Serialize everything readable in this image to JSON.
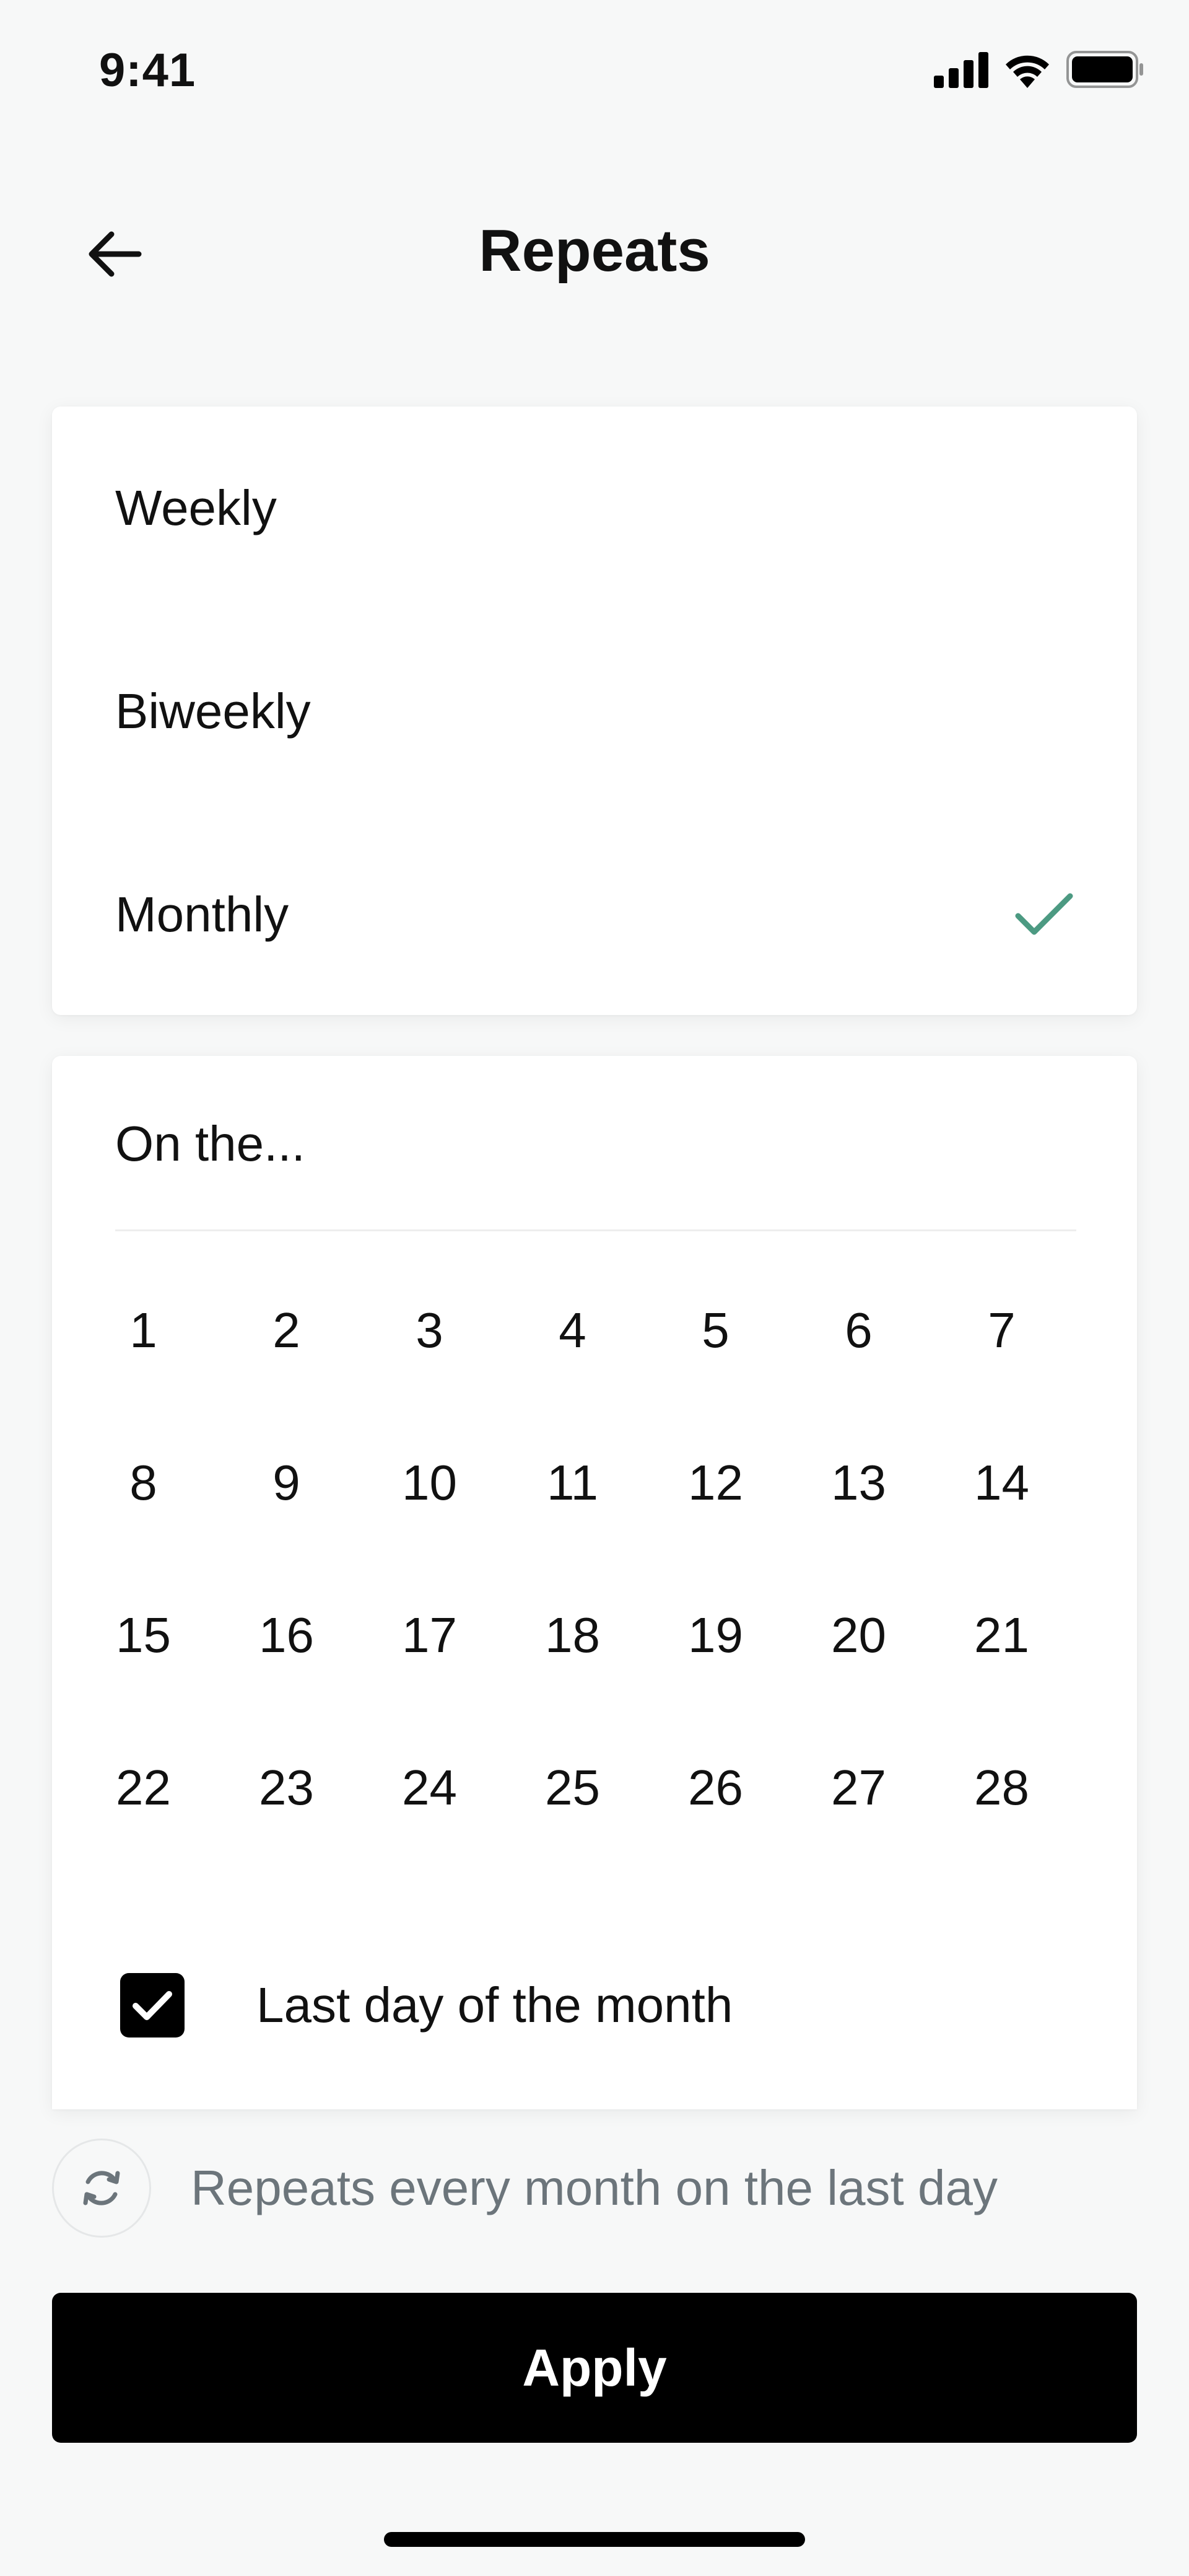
{
  "status_bar": {
    "time": "9:41",
    "icons": [
      "cellular-signal-icon",
      "wifi-icon",
      "battery-icon"
    ]
  },
  "header": {
    "title": "Repeats",
    "back_icon": "arrow-left-icon"
  },
  "frequency": {
    "options": [
      {
        "label": "Weekly",
        "selected": false
      },
      {
        "label": "Biweekly",
        "selected": false
      },
      {
        "label": "Monthly",
        "selected": true
      }
    ],
    "check_icon": "checkmark-icon",
    "accent_color": "#4c9a82"
  },
  "day_picker": {
    "heading": "On the...",
    "days": [
      "1",
      "2",
      "3",
      "4",
      "5",
      "6",
      "7",
      "8",
      "9",
      "10",
      "11",
      "12",
      "13",
      "14",
      "15",
      "16",
      "17",
      "18",
      "19",
      "20",
      "21",
      "22",
      "23",
      "24",
      "25",
      "26",
      "27",
      "28"
    ],
    "last_day_label": "Last day of the month",
    "last_day_checked": true
  },
  "summary": {
    "icon": "repeat-icon",
    "text": "Repeats every month on the last day"
  },
  "footer": {
    "apply_label": "Apply"
  }
}
